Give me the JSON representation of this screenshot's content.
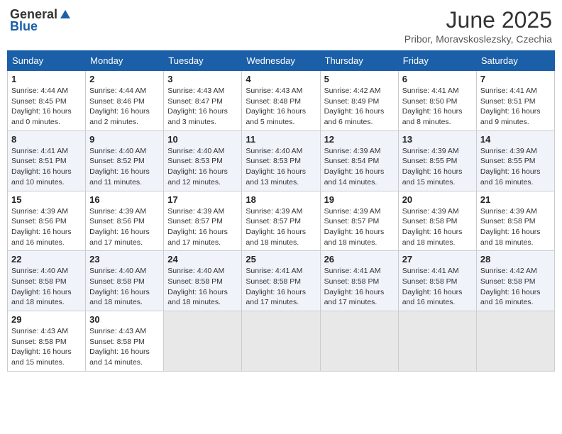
{
  "header": {
    "logo_general": "General",
    "logo_blue": "Blue",
    "month_title": "June 2025",
    "location": "Pribor, Moravskoslezsky, Czechia"
  },
  "weekdays": [
    "Sunday",
    "Monday",
    "Tuesday",
    "Wednesday",
    "Thursday",
    "Friday",
    "Saturday"
  ],
  "weeks": [
    [
      {
        "day": "1",
        "sunrise": "4:44 AM",
        "sunset": "8:45 PM",
        "daylight": "16 hours and 0 minutes."
      },
      {
        "day": "2",
        "sunrise": "4:44 AM",
        "sunset": "8:46 PM",
        "daylight": "16 hours and 2 minutes."
      },
      {
        "day": "3",
        "sunrise": "4:43 AM",
        "sunset": "8:47 PM",
        "daylight": "16 hours and 3 minutes."
      },
      {
        "day": "4",
        "sunrise": "4:43 AM",
        "sunset": "8:48 PM",
        "daylight": "16 hours and 5 minutes."
      },
      {
        "day": "5",
        "sunrise": "4:42 AM",
        "sunset": "8:49 PM",
        "daylight": "16 hours and 6 minutes."
      },
      {
        "day": "6",
        "sunrise": "4:41 AM",
        "sunset": "8:50 PM",
        "daylight": "16 hours and 8 minutes."
      },
      {
        "day": "7",
        "sunrise": "4:41 AM",
        "sunset": "8:51 PM",
        "daylight": "16 hours and 9 minutes."
      }
    ],
    [
      {
        "day": "8",
        "sunrise": "4:41 AM",
        "sunset": "8:51 PM",
        "daylight": "16 hours and 10 minutes."
      },
      {
        "day": "9",
        "sunrise": "4:40 AM",
        "sunset": "8:52 PM",
        "daylight": "16 hours and 11 minutes."
      },
      {
        "day": "10",
        "sunrise": "4:40 AM",
        "sunset": "8:53 PM",
        "daylight": "16 hours and 12 minutes."
      },
      {
        "day": "11",
        "sunrise": "4:40 AM",
        "sunset": "8:53 PM",
        "daylight": "16 hours and 13 minutes."
      },
      {
        "day": "12",
        "sunrise": "4:39 AM",
        "sunset": "8:54 PM",
        "daylight": "16 hours and 14 minutes."
      },
      {
        "day": "13",
        "sunrise": "4:39 AM",
        "sunset": "8:55 PM",
        "daylight": "16 hours and 15 minutes."
      },
      {
        "day": "14",
        "sunrise": "4:39 AM",
        "sunset": "8:55 PM",
        "daylight": "16 hours and 16 minutes."
      }
    ],
    [
      {
        "day": "15",
        "sunrise": "4:39 AM",
        "sunset": "8:56 PM",
        "daylight": "16 hours and 16 minutes."
      },
      {
        "day": "16",
        "sunrise": "4:39 AM",
        "sunset": "8:56 PM",
        "daylight": "16 hours and 17 minutes."
      },
      {
        "day": "17",
        "sunrise": "4:39 AM",
        "sunset": "8:57 PM",
        "daylight": "16 hours and 17 minutes."
      },
      {
        "day": "18",
        "sunrise": "4:39 AM",
        "sunset": "8:57 PM",
        "daylight": "16 hours and 18 minutes."
      },
      {
        "day": "19",
        "sunrise": "4:39 AM",
        "sunset": "8:57 PM",
        "daylight": "16 hours and 18 minutes."
      },
      {
        "day": "20",
        "sunrise": "4:39 AM",
        "sunset": "8:58 PM",
        "daylight": "16 hours and 18 minutes."
      },
      {
        "day": "21",
        "sunrise": "4:39 AM",
        "sunset": "8:58 PM",
        "daylight": "16 hours and 18 minutes."
      }
    ],
    [
      {
        "day": "22",
        "sunrise": "4:40 AM",
        "sunset": "8:58 PM",
        "daylight": "16 hours and 18 minutes."
      },
      {
        "day": "23",
        "sunrise": "4:40 AM",
        "sunset": "8:58 PM",
        "daylight": "16 hours and 18 minutes."
      },
      {
        "day": "24",
        "sunrise": "4:40 AM",
        "sunset": "8:58 PM",
        "daylight": "16 hours and 18 minutes."
      },
      {
        "day": "25",
        "sunrise": "4:41 AM",
        "sunset": "8:58 PM",
        "daylight": "16 hours and 17 minutes."
      },
      {
        "day": "26",
        "sunrise": "4:41 AM",
        "sunset": "8:58 PM",
        "daylight": "16 hours and 17 minutes."
      },
      {
        "day": "27",
        "sunrise": "4:41 AM",
        "sunset": "8:58 PM",
        "daylight": "16 hours and 16 minutes."
      },
      {
        "day": "28",
        "sunrise": "4:42 AM",
        "sunset": "8:58 PM",
        "daylight": "16 hours and 16 minutes."
      }
    ],
    [
      {
        "day": "29",
        "sunrise": "4:43 AM",
        "sunset": "8:58 PM",
        "daylight": "16 hours and 15 minutes."
      },
      {
        "day": "30",
        "sunrise": "4:43 AM",
        "sunset": "8:58 PM",
        "daylight": "16 hours and 14 minutes."
      },
      null,
      null,
      null,
      null,
      null
    ]
  ]
}
